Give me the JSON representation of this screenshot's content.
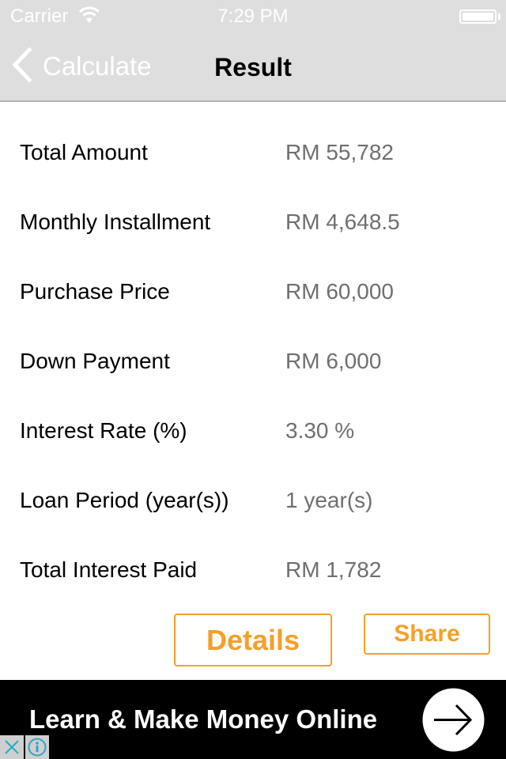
{
  "status_bar": {
    "carrier": "Carrier",
    "time": "7:29 PM",
    "wifi_icon": "wifi-icon",
    "battery_icon": "battery-full-icon"
  },
  "nav": {
    "back_label": "Calculate",
    "back_icon": "chevron-left-icon",
    "title": "Result"
  },
  "results": [
    {
      "label": "Total Amount",
      "value": "RM 55,782"
    },
    {
      "label": "Monthly Installment",
      "value": "RM 4,648.5"
    },
    {
      "label": "Purchase Price",
      "value": "RM 60,000"
    },
    {
      "label": "Down Payment",
      "value": "RM 6,000"
    },
    {
      "label": "Interest Rate (%)",
      "value": "3.30 %"
    },
    {
      "label": "Loan Period (year(s))",
      "value": "1 year(s)"
    },
    {
      "label": "Total Interest Paid",
      "value": "RM 1,782"
    }
  ],
  "buttons": {
    "details": "Details",
    "share": "Share"
  },
  "ad": {
    "text": "Learn & Make Money Online",
    "arrow_icon": "arrow-right-circle-icon",
    "close_icon": "close-icon",
    "info_icon": "info-icon"
  },
  "colors": {
    "accent": "#f5a028",
    "nav_background": "#dedede",
    "value_text": "#6f6f6f",
    "ad_background": "#000000",
    "ad_icon": "#2aa8c8"
  }
}
